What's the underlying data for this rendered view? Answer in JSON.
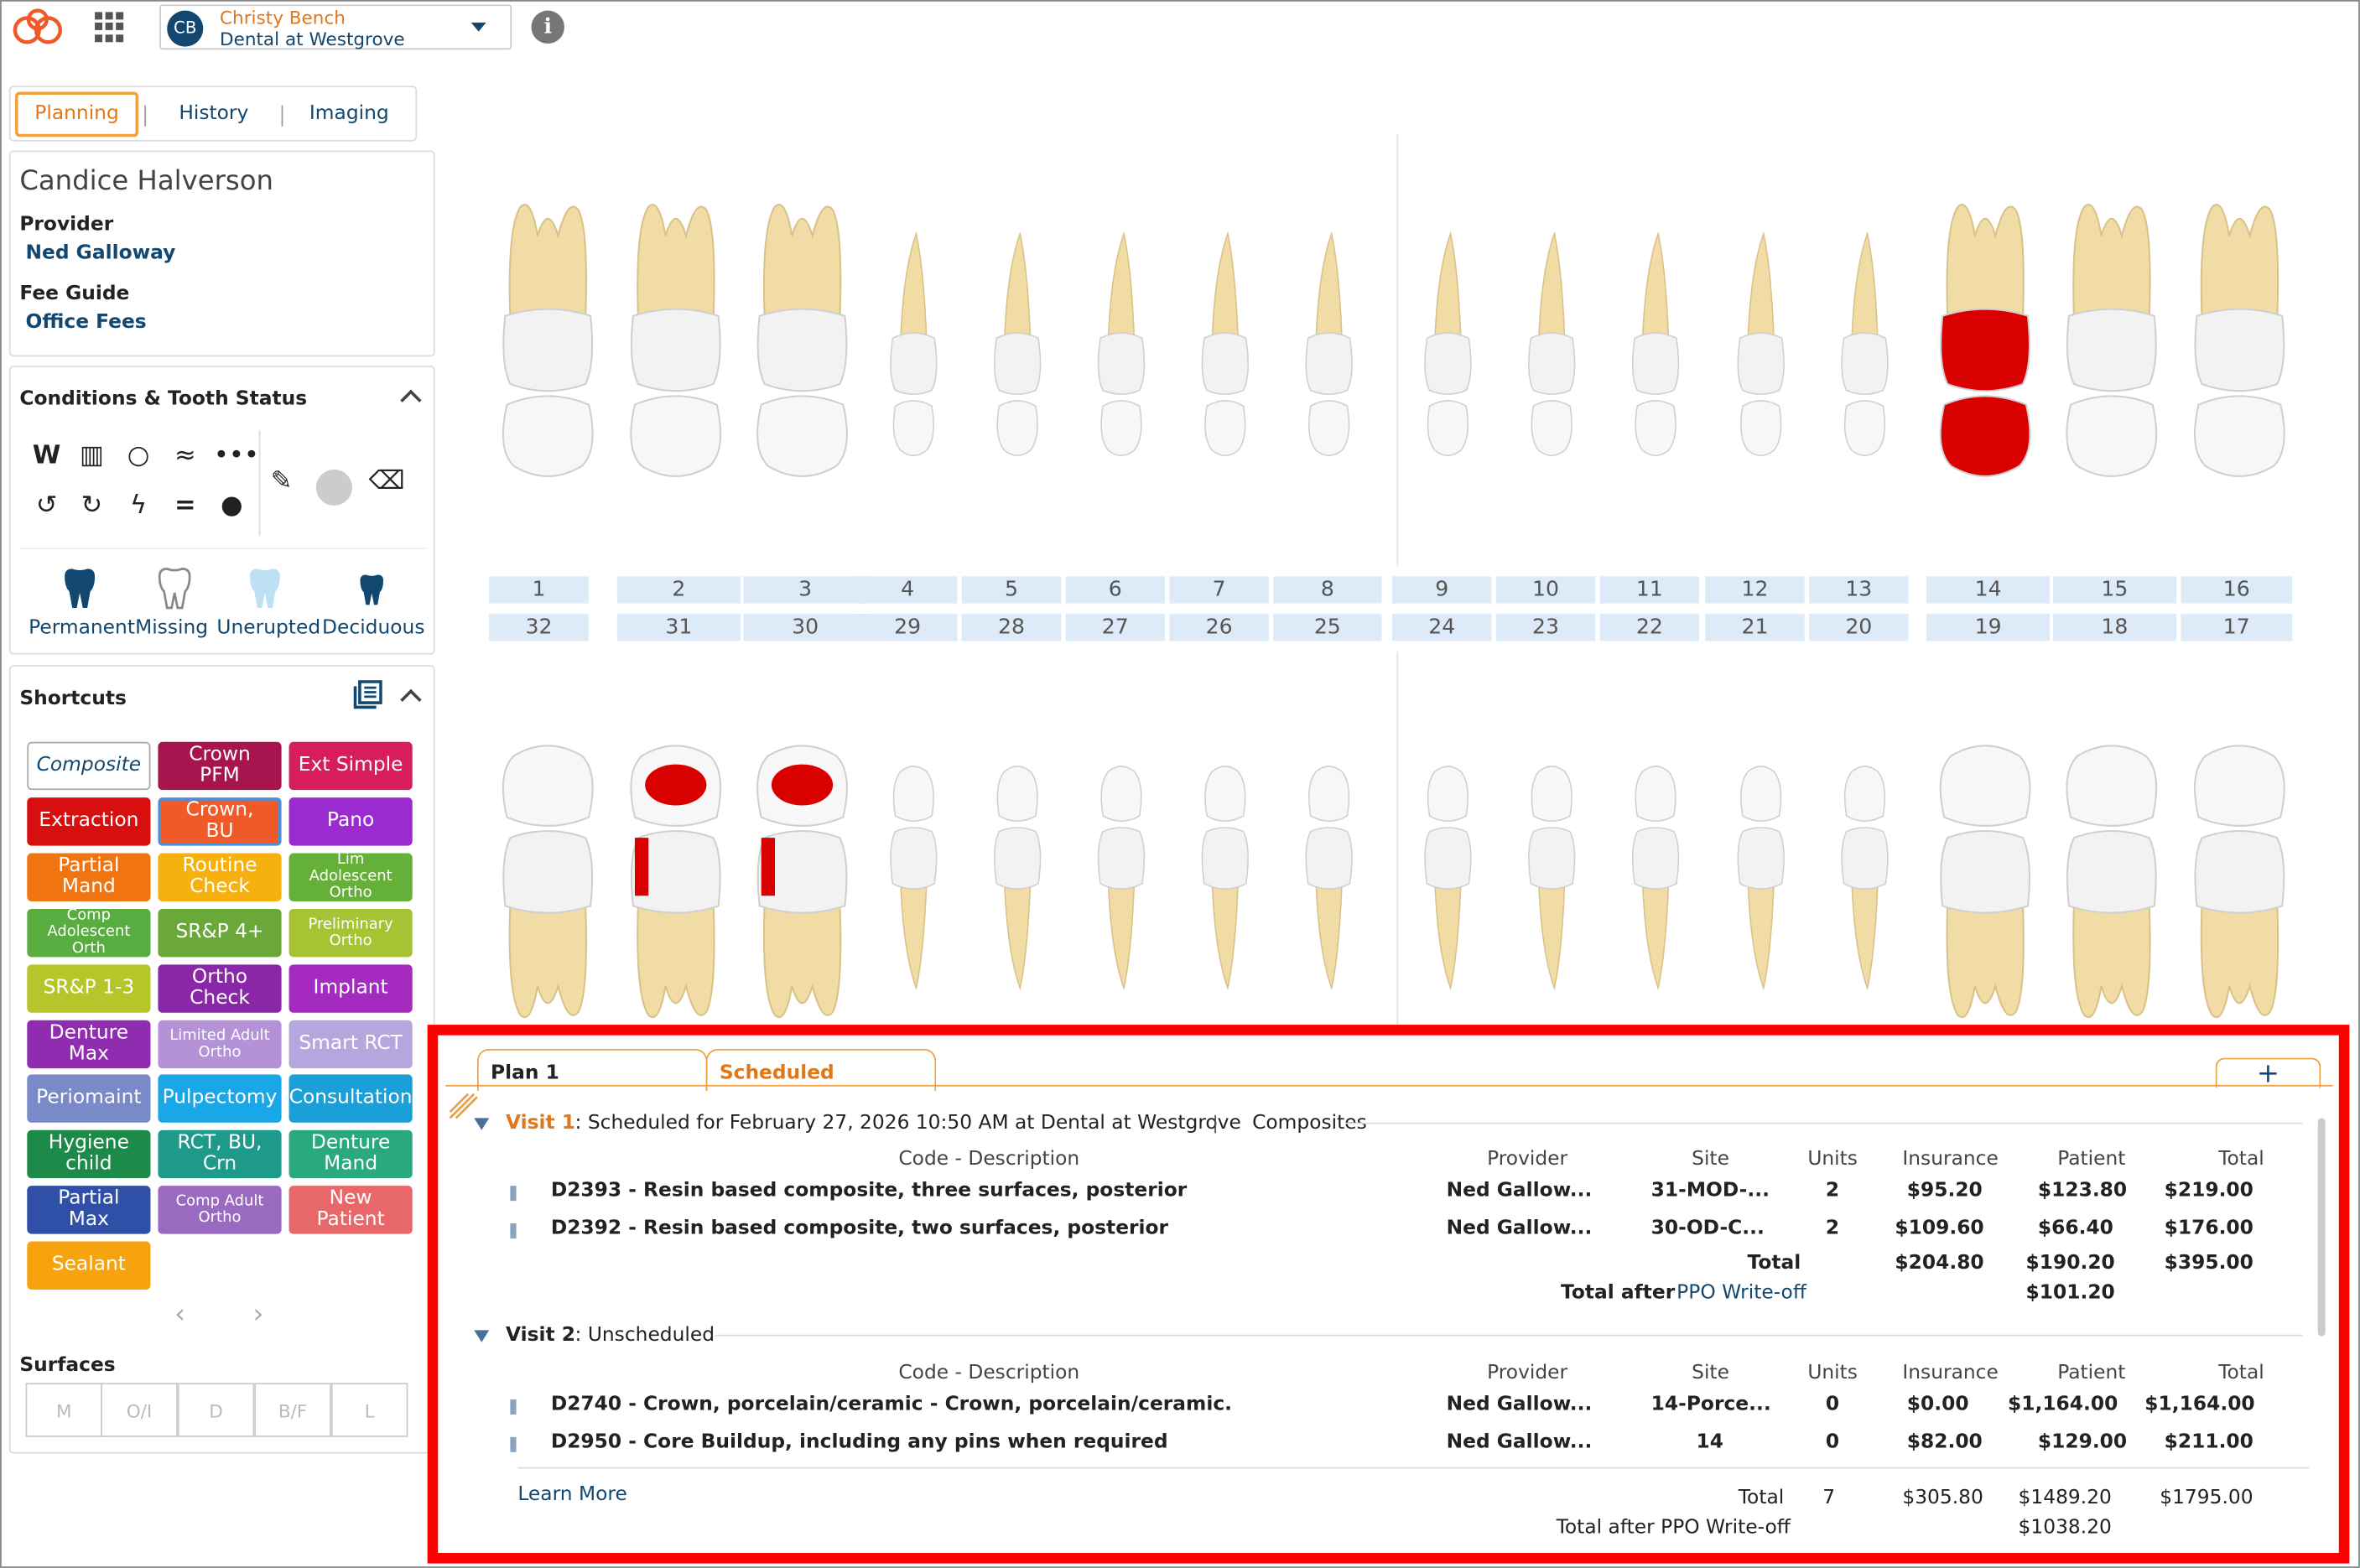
{
  "header": {
    "user_initials": "CB",
    "user_name": "Christy Bench",
    "office": "Dental at Westgrove",
    "info_glyph": "i"
  },
  "tabs": [
    {
      "label": "Planning",
      "active": true
    },
    {
      "label": "History",
      "active": false
    },
    {
      "label": "Imaging",
      "active": false
    }
  ],
  "patient": {
    "name": "Candice Halverson",
    "provider_label": "Provider",
    "provider": "Ned Galloway",
    "fee_guide_label": "Fee Guide",
    "fee_guide": "Office Fees"
  },
  "conditions": {
    "title": "Conditions & Tooth Status",
    "tooth_status": [
      "Permanent",
      "Missing",
      "Unerupted",
      "Deciduous"
    ]
  },
  "shortcuts": {
    "title": "Shortcuts",
    "items": [
      {
        "label": "Composite",
        "color": "#ffffff"
      },
      {
        "label": "Crown PFM",
        "color": "#a8154e"
      },
      {
        "label": "Ext Simple",
        "color": "#d61f5a"
      },
      {
        "label": "Extraction",
        "color": "#d80f0f"
      },
      {
        "label": "Crown, BU",
        "color": "#f05a28"
      },
      {
        "label": "Pano",
        "color": "#9b2ad1"
      },
      {
        "label": "Partial Mand",
        "color": "#f07510"
      },
      {
        "label": "Routine Check",
        "color": "#f6b10e"
      },
      {
        "label": "Lim Adolescent Ortho",
        "color": "#64b039"
      },
      {
        "label": "Comp Adolescent Orth",
        "color": "#58ac40"
      },
      {
        "label": "SR&P 4+",
        "color": "#6aa839"
      },
      {
        "label": "Preliminary Ortho",
        "color": "#a7c232"
      },
      {
        "label": "SR&P 1-3",
        "color": "#b5c52a"
      },
      {
        "label": "Ortho Check",
        "color": "#8a27a8"
      },
      {
        "label": "Implant",
        "color": "#a52bc0"
      },
      {
        "label": "Denture Max",
        "color": "#8f2cb0"
      },
      {
        "label": "Limited Adult Ortho",
        "color": "#b392d8"
      },
      {
        "label": "Smart RCT",
        "color": "#b6a6de"
      },
      {
        "label": "Periomaint",
        "color": "#7a89c8"
      },
      {
        "label": "Pulpectomy",
        "color": "#1aa7e8"
      },
      {
        "label": "Consultation",
        "color": "#1a9fd8"
      },
      {
        "label": "Hygiene child",
        "color": "#1e8a4a"
      },
      {
        "label": "RCT, BU, Crn",
        "color": "#1e9a8a"
      },
      {
        "label": "Denture Mand",
        "color": "#2aa880"
      },
      {
        "label": "Partial Max",
        "color": "#3050a8"
      },
      {
        "label": "Comp Adult Ortho",
        "color": "#9a6ac0"
      },
      {
        "label": "New Patient",
        "color": "#e8686a"
      },
      {
        "label": "Sealant",
        "color": "#f6a30e"
      }
    ]
  },
  "surfaces": {
    "title": "Surfaces",
    "items": [
      "M",
      "O/I",
      "D",
      "B/F",
      "L"
    ]
  },
  "chart": {
    "upper_numbers": [
      "1",
      "2",
      "3",
      "4",
      "5",
      "6",
      "7",
      "8",
      "9",
      "10",
      "11",
      "12",
      "13",
      "14",
      "15",
      "16"
    ],
    "lower_numbers": [
      "32",
      "31",
      "30",
      "29",
      "28",
      "27",
      "26",
      "25",
      "24",
      "23",
      "22",
      "21",
      "20",
      "19",
      "18",
      "17"
    ]
  },
  "plan": {
    "tabs": [
      "Plan 1",
      "Scheduled"
    ],
    "add_glyph": "+",
    "headers": {
      "code": "Code - Description",
      "provider": "Provider",
      "site": "Site",
      "units": "Units",
      "insurance": "Insurance",
      "patient": "Patient",
      "total": "Total"
    },
    "visit1": {
      "label": "Visit 1",
      "status": ": Scheduled for February 27, 2026 10:50 AM at Dental at Westgrove",
      "name": "Composites",
      "rows": [
        {
          "code": "D2393 - Resin based composite, three surfaces, posterior",
          "provider": "Ned Gallow...",
          "site": "31-MOD-...",
          "units": "2",
          "insurance": "$95.20",
          "patient": "$123.80",
          "total": "$219.00"
        },
        {
          "code": "D2392 - Resin based composite, two surfaces, posterior",
          "provider": "Ned Gallow...",
          "site": "30-OD-C...",
          "units": "2",
          "insurance": "$109.60",
          "patient": "$66.40",
          "total": "$176.00"
        }
      ],
      "total_label": "Total",
      "total_insurance": "$204.80",
      "total_patient": "$190.20",
      "total_total": "$395.00",
      "after_label": "Total after",
      "after_link": "PPO Write-off",
      "after_value": "$101.20"
    },
    "visit2": {
      "label": "Visit 2",
      "status": ": Unscheduled",
      "rows": [
        {
          "code": "D2740 - Crown, porcelain/ceramic - Crown, porcelain/ceramic.",
          "provider": "Ned Gallow...",
          "site": "14-Porce...",
          "units": "0",
          "insurance": "$0.00",
          "patient": "$1,164.00",
          "total": "$1,164.00"
        },
        {
          "code": "D2950 - Core Buildup, including any pins when required",
          "provider": "Ned Gallow...",
          "site": "14",
          "units": "0",
          "insurance": "$82.00",
          "patient": "$129.00",
          "total": "$211.00"
        }
      ]
    },
    "footer": {
      "learn_more": "Learn More",
      "total_label": "Total",
      "units": "7",
      "insurance": "$305.80",
      "patient": "$1489.20",
      "total": "$1795.00",
      "after_label": "Total after PPO Write-off",
      "after_value": "$1038.20"
    }
  }
}
